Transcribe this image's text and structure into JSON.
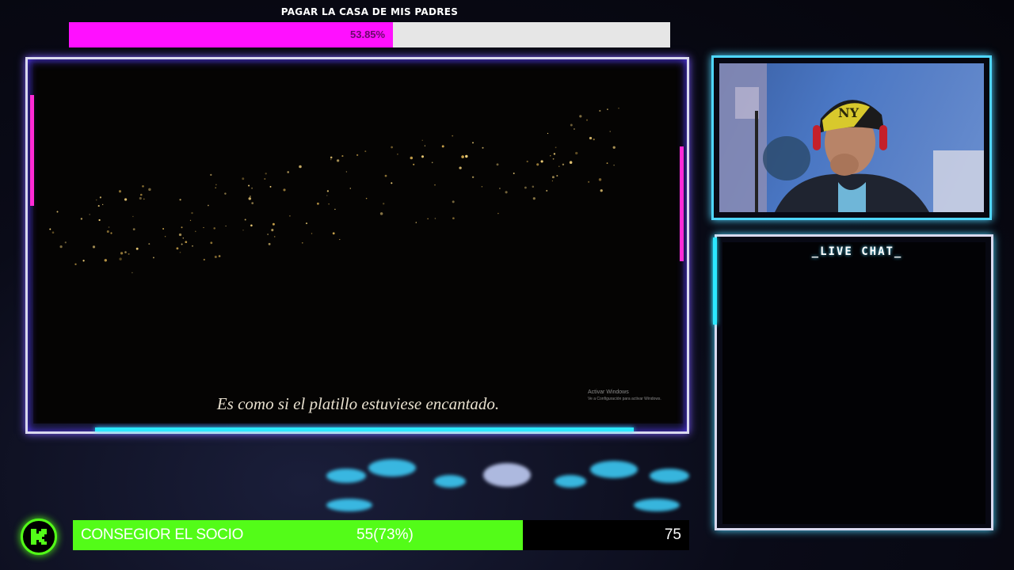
{
  "top_goal": {
    "title": "PAGAR LA CASA DE MIS PADRES",
    "percent_text": "53.85%",
    "progress_percent": 53.85,
    "fill_color": "#ff10ff"
  },
  "game": {
    "subtitle": "Es como si el platillo estuviese encantado.",
    "activate_windows": "Activar Windows",
    "activate_windows_sub": "Ve a Configuración para activar Windows."
  },
  "chat": {
    "title": "_LIVE CHAT_"
  },
  "bottom_goal": {
    "logo_icon": "kick-logo-icon",
    "label": "CONSEGIOR EL SOCIO",
    "progress_text": "55(73%)",
    "progress_percent": 73,
    "target": "75",
    "fill_color": "#53fc18"
  }
}
